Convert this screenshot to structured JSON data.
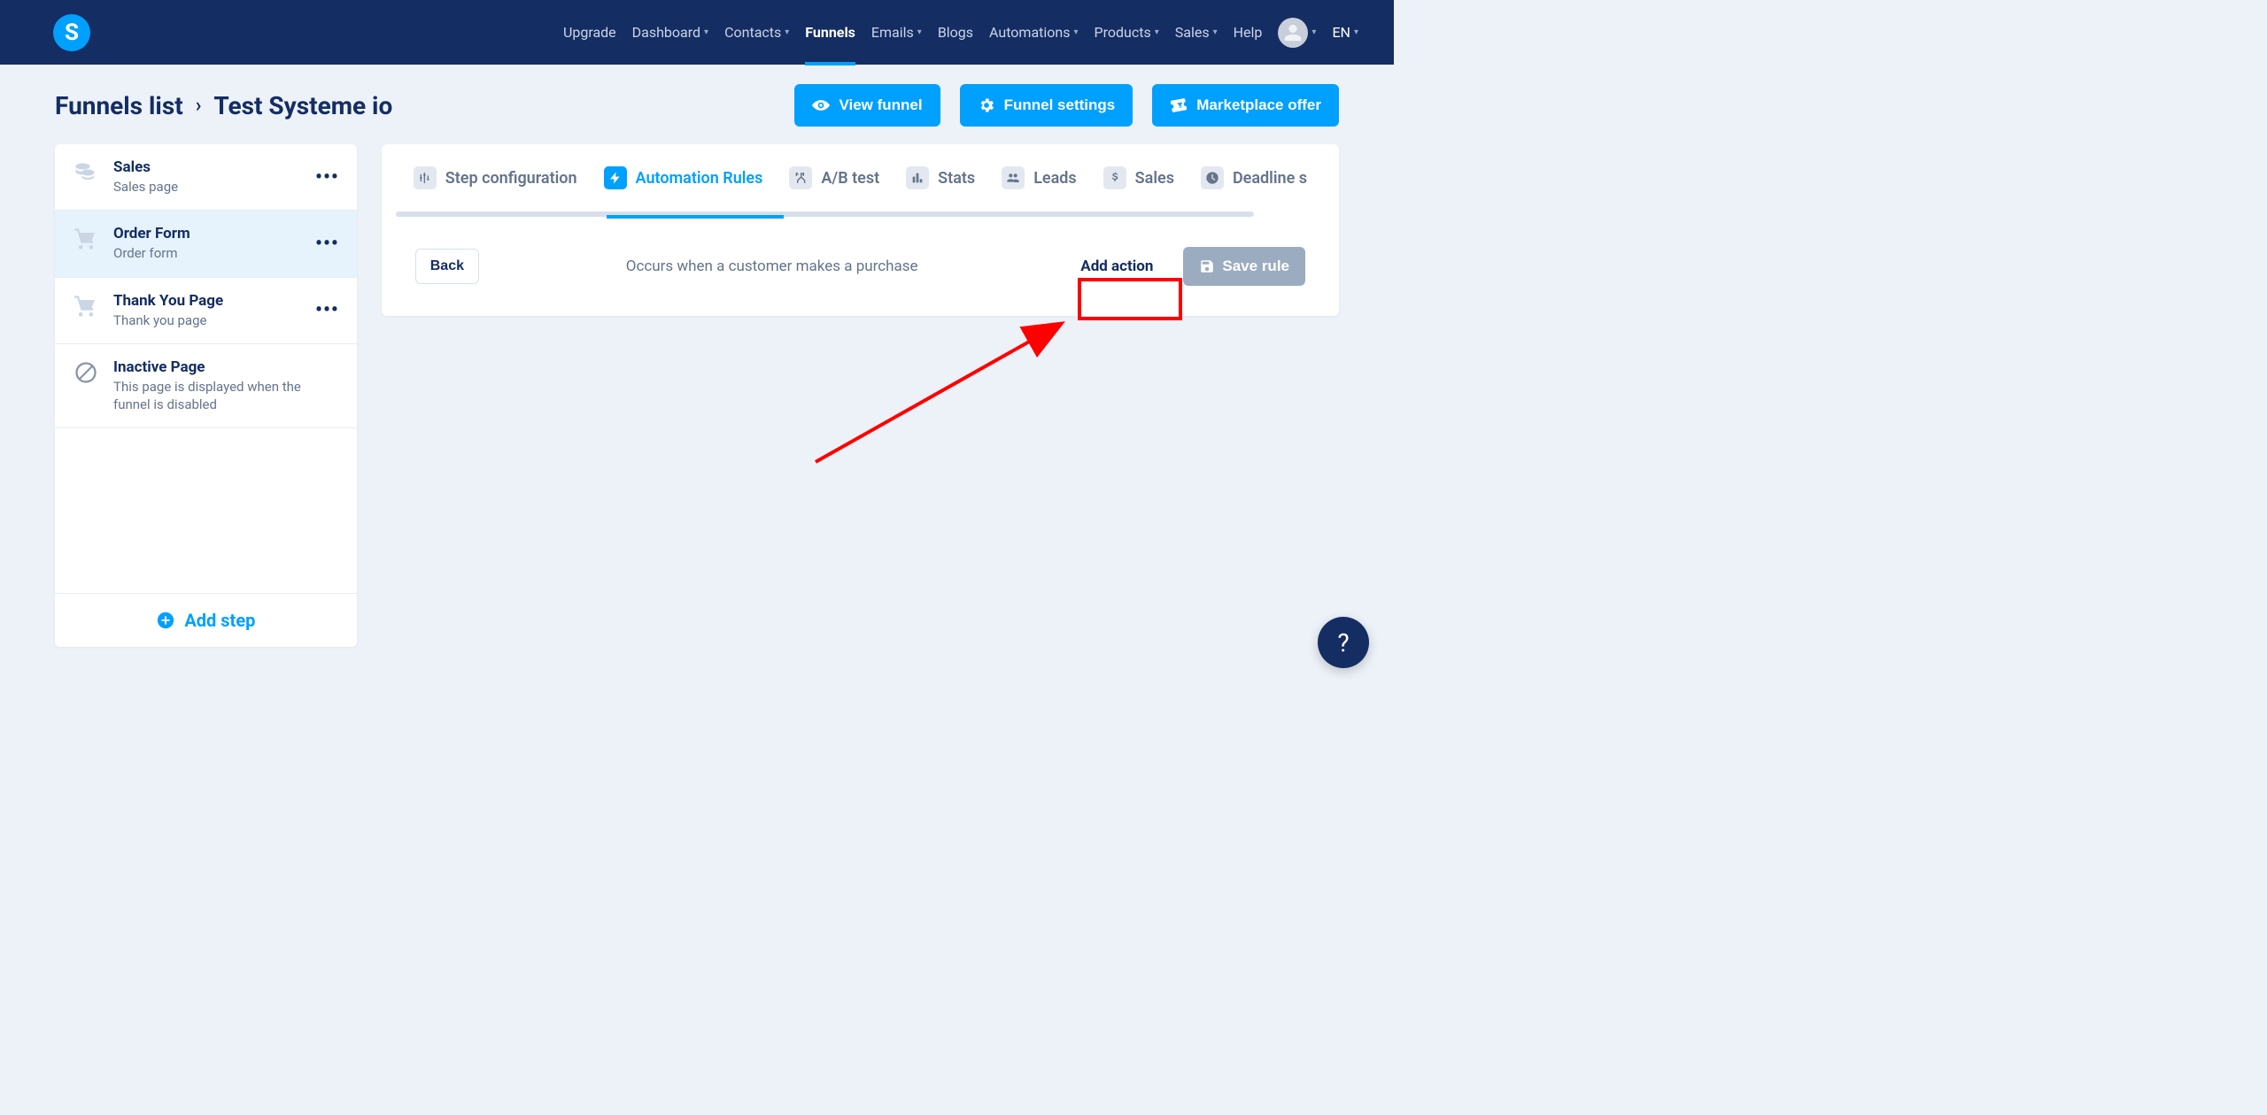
{
  "nav": {
    "upgrade": "Upgrade",
    "dashboard": "Dashboard",
    "contacts": "Contacts",
    "funnels": "Funnels",
    "emails": "Emails",
    "blogs": "Blogs",
    "automations": "Automations",
    "products": "Products",
    "sales": "Sales",
    "help": "Help",
    "lang": "EN",
    "logo_letter": "S"
  },
  "breadcrumb": {
    "root": "Funnels list",
    "current": "Test Systeme io"
  },
  "head_actions": {
    "view_funnel": "View funnel",
    "funnel_settings": "Funnel settings",
    "marketplace_offer": "Marketplace offer"
  },
  "sidebar": {
    "steps": [
      {
        "title": "Sales",
        "sub": "Sales page",
        "icon": "coins",
        "has_menu": true
      },
      {
        "title": "Order Form",
        "sub": "Order form",
        "icon": "cart",
        "has_menu": true
      },
      {
        "title": "Thank You Page",
        "sub": "Thank you page",
        "icon": "cart-check",
        "has_menu": true
      },
      {
        "title": "Inactive Page",
        "sub": "This page is displayed when the funnel is disabled",
        "icon": "ban",
        "has_menu": false
      }
    ],
    "add_label": "Add step"
  },
  "tabs": [
    {
      "id": "step-config",
      "label": "Step configuration"
    },
    {
      "id": "automation-rules",
      "label": "Automation Rules"
    },
    {
      "id": "ab-test",
      "label": "A/B test"
    },
    {
      "id": "stats",
      "label": "Stats"
    },
    {
      "id": "leads",
      "label": "Leads"
    },
    {
      "id": "sales",
      "label": "Sales"
    },
    {
      "id": "deadline",
      "label": "Deadline s"
    }
  ],
  "rule": {
    "back": "Back",
    "description": "Occurs when a customer makes a purchase",
    "add_action": "Add action",
    "save_rule": "Save rule"
  },
  "help_symbol": "?"
}
